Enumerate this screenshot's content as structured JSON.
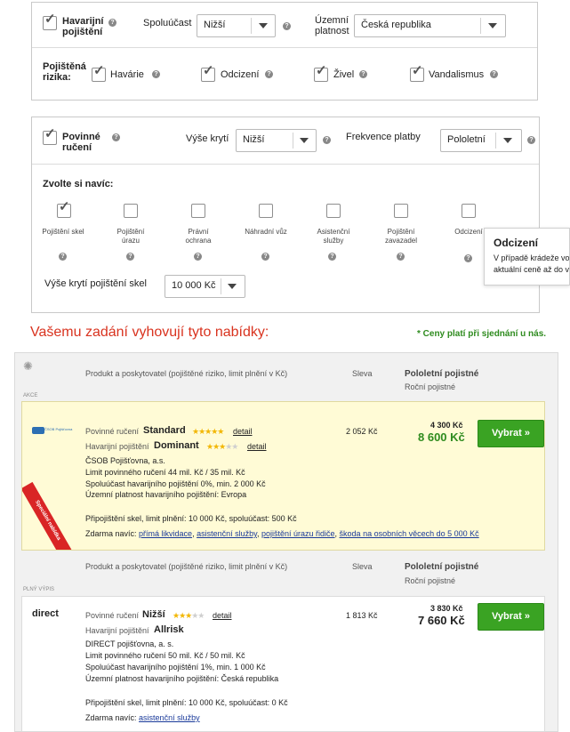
{
  "insurance1": {
    "label": "Havarijní pojištění",
    "spoluucast_label": "Spoluúčast",
    "spoluucast_value": "Nižší",
    "uzemni_label": "Územní platnost",
    "uzemni_value": "Česká republika",
    "risks_label": "Pojištěná rizika:",
    "risks": [
      "Havárie",
      "Odcizení",
      "Živel",
      "Vandalismus"
    ]
  },
  "insurance2": {
    "label": "Povinné ručení",
    "vyse_label": "Výše krytí",
    "vyse_value": "Nižší",
    "frekvence_label": "Frekvence platby",
    "frekvence_value": "Pololetní",
    "extras_label": "Zvolte si navíc:",
    "extras": [
      "Pojištění skel",
      "Pojištění úrazu",
      "Právní ochrana",
      "Náhradní vůz",
      "Asistenční služby",
      "Pojištění zavazadel",
      "Odcizení"
    ],
    "glass_label": "Výše krytí pojištění skel",
    "glass_value": "10 000 Kč"
  },
  "tooltip": {
    "title": "Odcizení",
    "text1": "V případě krádeže vo",
    "text2": "aktuální ceně až do v"
  },
  "results": {
    "heading": "Vašemu zadání vyhovují tyto nabídky:",
    "note": "* Ceny platí při sjednání u nás.",
    "col_product": "Produkt a poskytovatel (pojištěné riziko, limit plnění v Kč)",
    "col_discount": "Sleva",
    "col_price1": "Pololetní pojistné",
    "col_price2": "Roční pojistné",
    "section1": "AKCE",
    "section2": "PLNÝ VÝPIS",
    "ribbon": "Speciální nabídka",
    "button": "Vybrat »"
  },
  "offers": [
    {
      "logo": "ČSOB Pojišťovna",
      "pr_label": "Povinné ručení",
      "pr_name": "Standard",
      "pr_stars": 5,
      "hp_label": "Havarijní pojištění",
      "hp_name": "Dominant",
      "hp_stars": 3.5,
      "detail": "detail",
      "company": "ČSOB Pojišťovna, a.s.",
      "line1": "Limit povinného ručení 44 mil. Kč / 35 mil. Kč",
      "line2": "Spoluúčast havarijního pojištění 0%, min. 2 000 Kč",
      "line3": "Územní platnost havarijního pojištění: Evropa",
      "glass": "Připojištění skel, limit plnění: 10 000 Kč, spoluúčast: 500 Kč",
      "free_label": "Zdarma navíc:",
      "free": [
        "přímá likvidace",
        "asistenční služby",
        "pojištění úrazu řidiče",
        "škoda na osobních věcech do 5 000 Kč"
      ],
      "discount": "2 052 Kč",
      "price_half": "4 300 Kč",
      "price_year": "8 600 Kč"
    },
    {
      "logo": "direct",
      "pr_label": "Povinné ručení",
      "pr_name": "Nižší",
      "pr_stars": 3,
      "hp_label": "Havarijní pojištění",
      "hp_name": "Allrisk",
      "detail": "detail",
      "company": "DIRECT pojišťovna, a. s.",
      "line1": "Limit povinného ručení 50 mil. Kč / 50 mil. Kč",
      "line2": "Spoluúčast havarijního pojištění 1%, min. 1 000 Kč",
      "line3": "Územní platnost havarijního pojištění: Česká republika",
      "glass": "Připojištění skel, limit plnění: 10 000 Kč, spoluúčast: 0 Kč",
      "free_label": "Zdarma navíc:",
      "free": [
        "asistenční služby"
      ],
      "discount": "1 813 Kč",
      "price_half": "3 830 Kč",
      "price_year": "7 660 Kč"
    }
  ],
  "colors": {
    "accent": "#3aa323",
    "heading": "#d9331f",
    "note": "#2e8b1e",
    "offer_bg": "#fffbd6",
    "link": "#1a3a9a"
  }
}
